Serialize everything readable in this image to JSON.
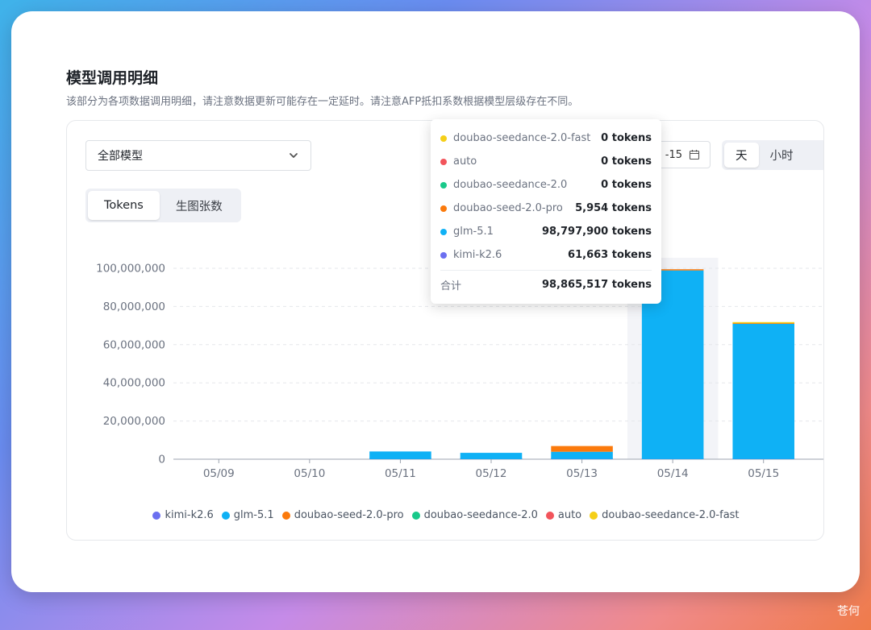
{
  "header": {
    "title": "模型调用明细",
    "subtitle": "该部分为各项数据调用明细，请注意数据更新可能存在一定延时。请注意AFP抵扣系数根据模型层级存在不同。"
  },
  "filters": {
    "model_select": "全部模型",
    "date_tail": "-15",
    "granularity": [
      "天",
      "小时"
    ],
    "granularity_active": 0
  },
  "metric_tabs": {
    "items": [
      "Tokens",
      "生图张数"
    ],
    "active": 0
  },
  "series_colors": {
    "kimi-k2.6": "#6b6ff0",
    "glm-5.1": "#0fb1f5",
    "doubao-seed-2.0-pro": "#fb7a0c",
    "doubao-seedance-2.0": "#19c98a",
    "auto": "#f2545b",
    "doubao-seedance-2.0-fast": "#f5cf18"
  },
  "chart_data": {
    "type": "bar",
    "stacked": true,
    "categories": [
      "05/09",
      "05/10",
      "05/11",
      "05/12",
      "05/13",
      "05/14",
      "05/15"
    ],
    "ylim": [
      0,
      100000000
    ],
    "yticks": [
      0,
      20000000,
      40000000,
      60000000,
      80000000,
      100000000
    ],
    "ytick_labels": [
      "0",
      "20,000,000",
      "40,000,000",
      "60,000,000",
      "80,000,000",
      "100,000,000"
    ],
    "grid": true,
    "legend_position": "bottom",
    "highlight_category": "05/14",
    "series": [
      {
        "name": "kimi-k2.6",
        "values": [
          0,
          0,
          50000,
          40000,
          100000,
          61663,
          80000
        ]
      },
      {
        "name": "glm-5.1",
        "values": [
          0,
          0,
          4000000,
          3300000,
          3800000,
          98797900,
          70800000
        ]
      },
      {
        "name": "doubao-seed-2.0-pro",
        "values": [
          0,
          0,
          0,
          0,
          3000000,
          5954,
          300000
        ]
      },
      {
        "name": "doubao-seedance-2.0",
        "values": [
          0,
          0,
          0,
          0,
          0,
          0,
          0
        ]
      },
      {
        "name": "auto",
        "values": [
          0,
          0,
          0,
          0,
          0,
          0,
          0
        ]
      },
      {
        "name": "doubao-seedance-2.0-fast",
        "values": [
          0,
          0,
          0,
          0,
          0,
          0,
          600000
        ]
      }
    ]
  },
  "tooltip": {
    "rows": [
      {
        "name": "doubao-seedance-2.0-fast",
        "value": "0 tokens"
      },
      {
        "name": "auto",
        "value": "0 tokens"
      },
      {
        "name": "doubao-seedance-2.0",
        "value": "0 tokens"
      },
      {
        "name": "doubao-seed-2.0-pro",
        "value": "5,954 tokens"
      },
      {
        "name": "glm-5.1",
        "value": "98,797,900 tokens"
      },
      {
        "name": "kimi-k2.6",
        "value": "61,663 tokens"
      }
    ],
    "total_label": "合计",
    "total_value": "98,865,517 tokens"
  },
  "watermark": "苍何"
}
